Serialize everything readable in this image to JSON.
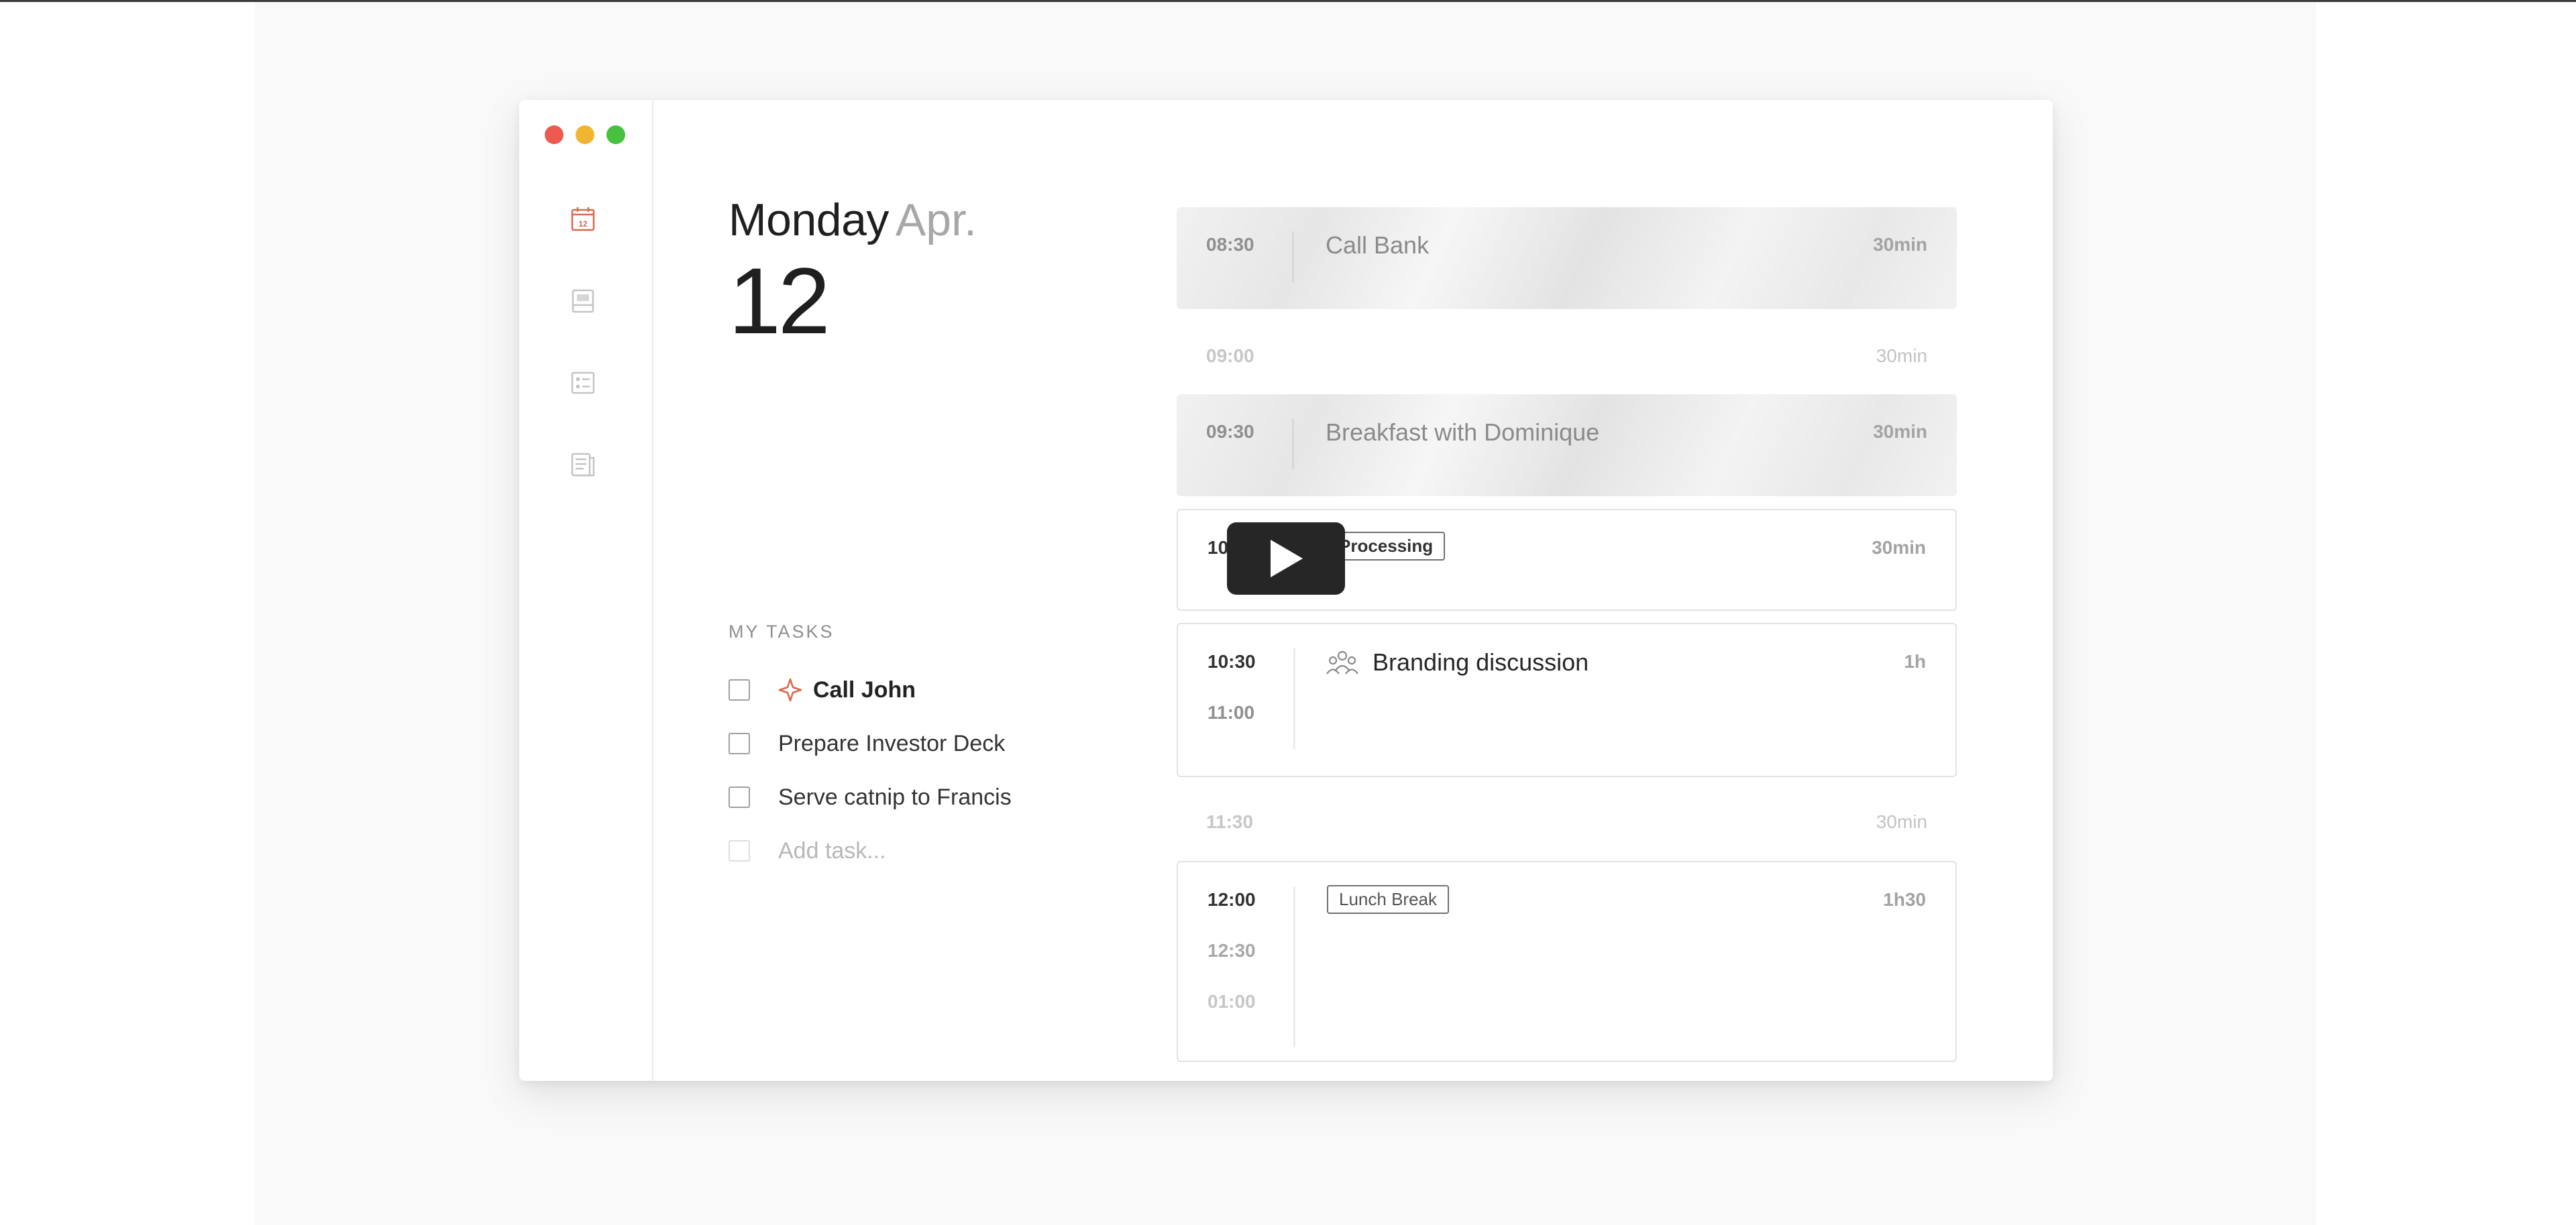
{
  "window": {
    "traffic_lights": {
      "close": "#ed5a50",
      "minimize": "#f1b631",
      "zoom": "#47c13f"
    }
  },
  "sidebar": {
    "icons": [
      {
        "name": "calendar-icon",
        "label": "12",
        "active": true
      },
      {
        "name": "inbox-icon",
        "active": false
      },
      {
        "name": "checklist-icon",
        "active": false
      },
      {
        "name": "notes-icon",
        "active": false
      }
    ]
  },
  "date": {
    "weekday": "Monday",
    "month": "Apr.",
    "day": "12"
  },
  "tasks": {
    "title": "MY TASKS",
    "items": [
      {
        "label": "Call John",
        "priority": true,
        "icon": "star-icon"
      },
      {
        "label": "Prepare Investor Deck"
      },
      {
        "label": "Serve catnip to Francis"
      }
    ],
    "add_placeholder": "Add task..."
  },
  "schedule": {
    "events": [
      {
        "time": "08:30",
        "title": "Call Bank",
        "duration": "30min"
      },
      {
        "time": "09:00",
        "duration": "30min"
      },
      {
        "time": "09:30",
        "title": "Breakfast with Dominique",
        "duration": "30min"
      },
      {
        "time": "10:00",
        "tag": "Processing",
        "duration": "30min"
      },
      {
        "time": "10:30",
        "time_end": "11:00",
        "title": "Branding discussion",
        "duration": "1h",
        "icon": "group-icon"
      },
      {
        "time": "11:30",
        "duration": "30min"
      },
      {
        "time": "12:00",
        "times_extra": [
          "12:30",
          "01:00"
        ],
        "tag": "Lunch Break",
        "duration": "1h30"
      }
    ]
  },
  "accent": "#d9694a"
}
